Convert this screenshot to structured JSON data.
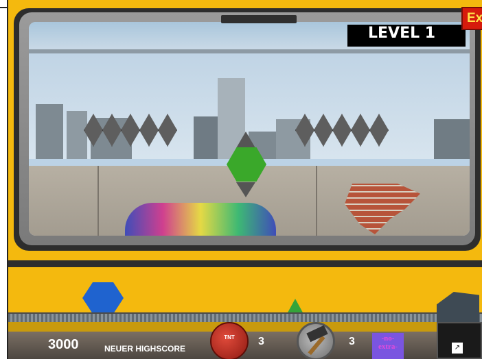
{
  "game": {
    "level_label": "LEVEL 1",
    "exit_label": "Exit"
  },
  "hud": {
    "score": "3000",
    "highscore_label": "NEUER HIGHSCORE",
    "dynamite": {
      "icon": "dynamite-icon",
      "label": "TNT",
      "count": "3"
    },
    "hammer": {
      "icon": "hammer-icon",
      "count": "3"
    },
    "extra_label": "-no- extra-"
  },
  "colors": {
    "background": "#f4b90e",
    "paddle": "#1f63cf",
    "green_gem": "#3aa82a",
    "exit": "#d61b0c"
  }
}
